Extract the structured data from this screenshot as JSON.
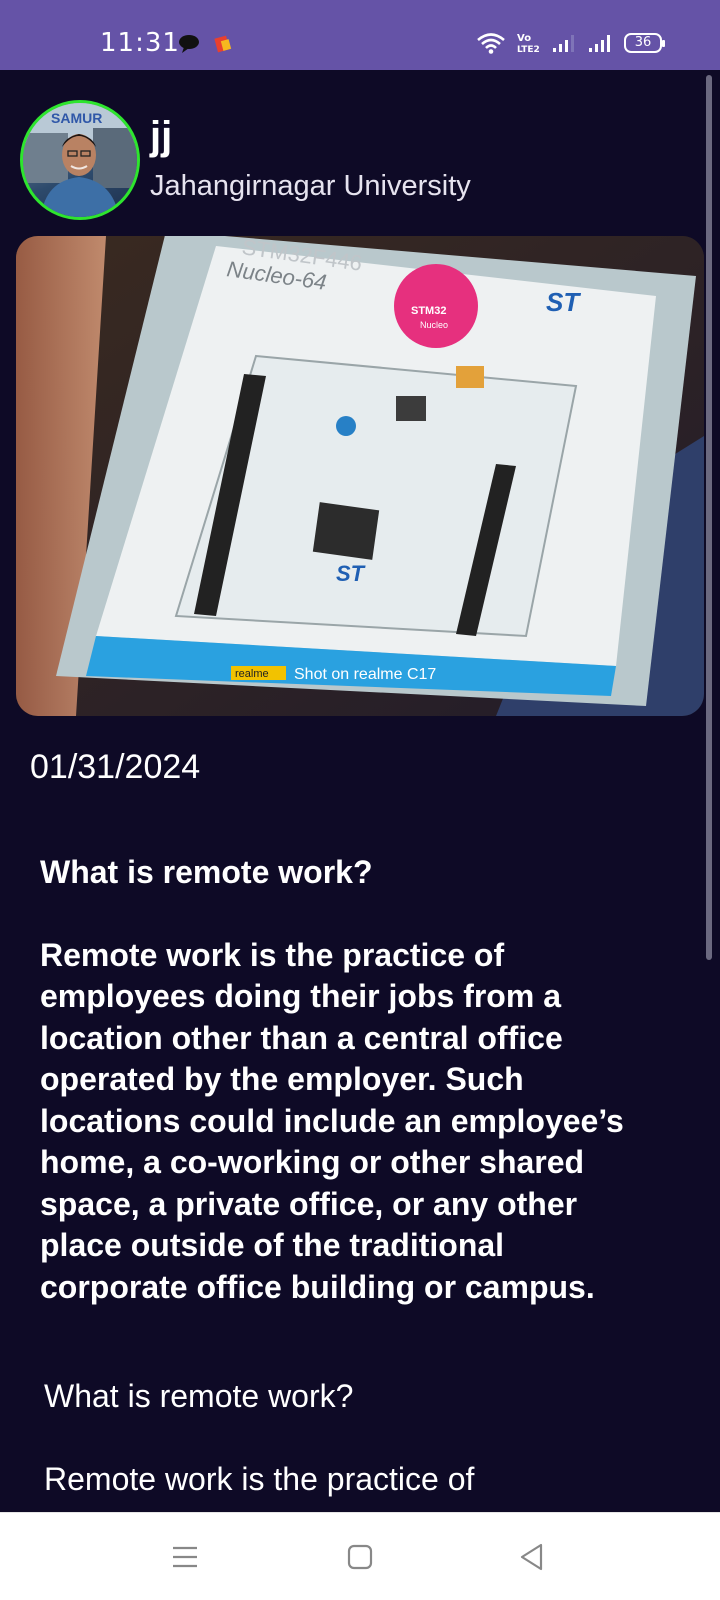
{
  "status_bar": {
    "time": "11:31",
    "battery": "36",
    "background": "#6553a7"
  },
  "profile": {
    "name": "jj",
    "organization": "Jahangirnagar University",
    "avatar_ring_color": "#2ee52e"
  },
  "post": {
    "image_caption": {
      "brand": "realme",
      "text": "Shot on realme C17"
    },
    "board_labels": {
      "model": "STM32F446",
      "series": "Nucleo-64",
      "badge_top": "STM32",
      "badge_bottom": "Nucleo"
    },
    "date": "01/31/2024",
    "title": "What is remote work?",
    "body": "Remote work is the practice of employees doing their jobs from a location other than a central office operated by the employer. Such locations could include an employee’s home, a co-working or other shared space, a private office, or any other place outside of the traditional corporate office building or campus.",
    "repeat_title": "What is remote work?",
    "repeat_body": "Remote work is the practice of"
  },
  "colors": {
    "background": "#0e0a26",
    "text": "#ffffff"
  },
  "icons": [
    "chat-bubble-icon",
    "app-notification-icon",
    "wifi-icon",
    "volte-icon",
    "signal-icon",
    "battery-icon",
    "menu-icon",
    "home-icon",
    "back-icon"
  ]
}
